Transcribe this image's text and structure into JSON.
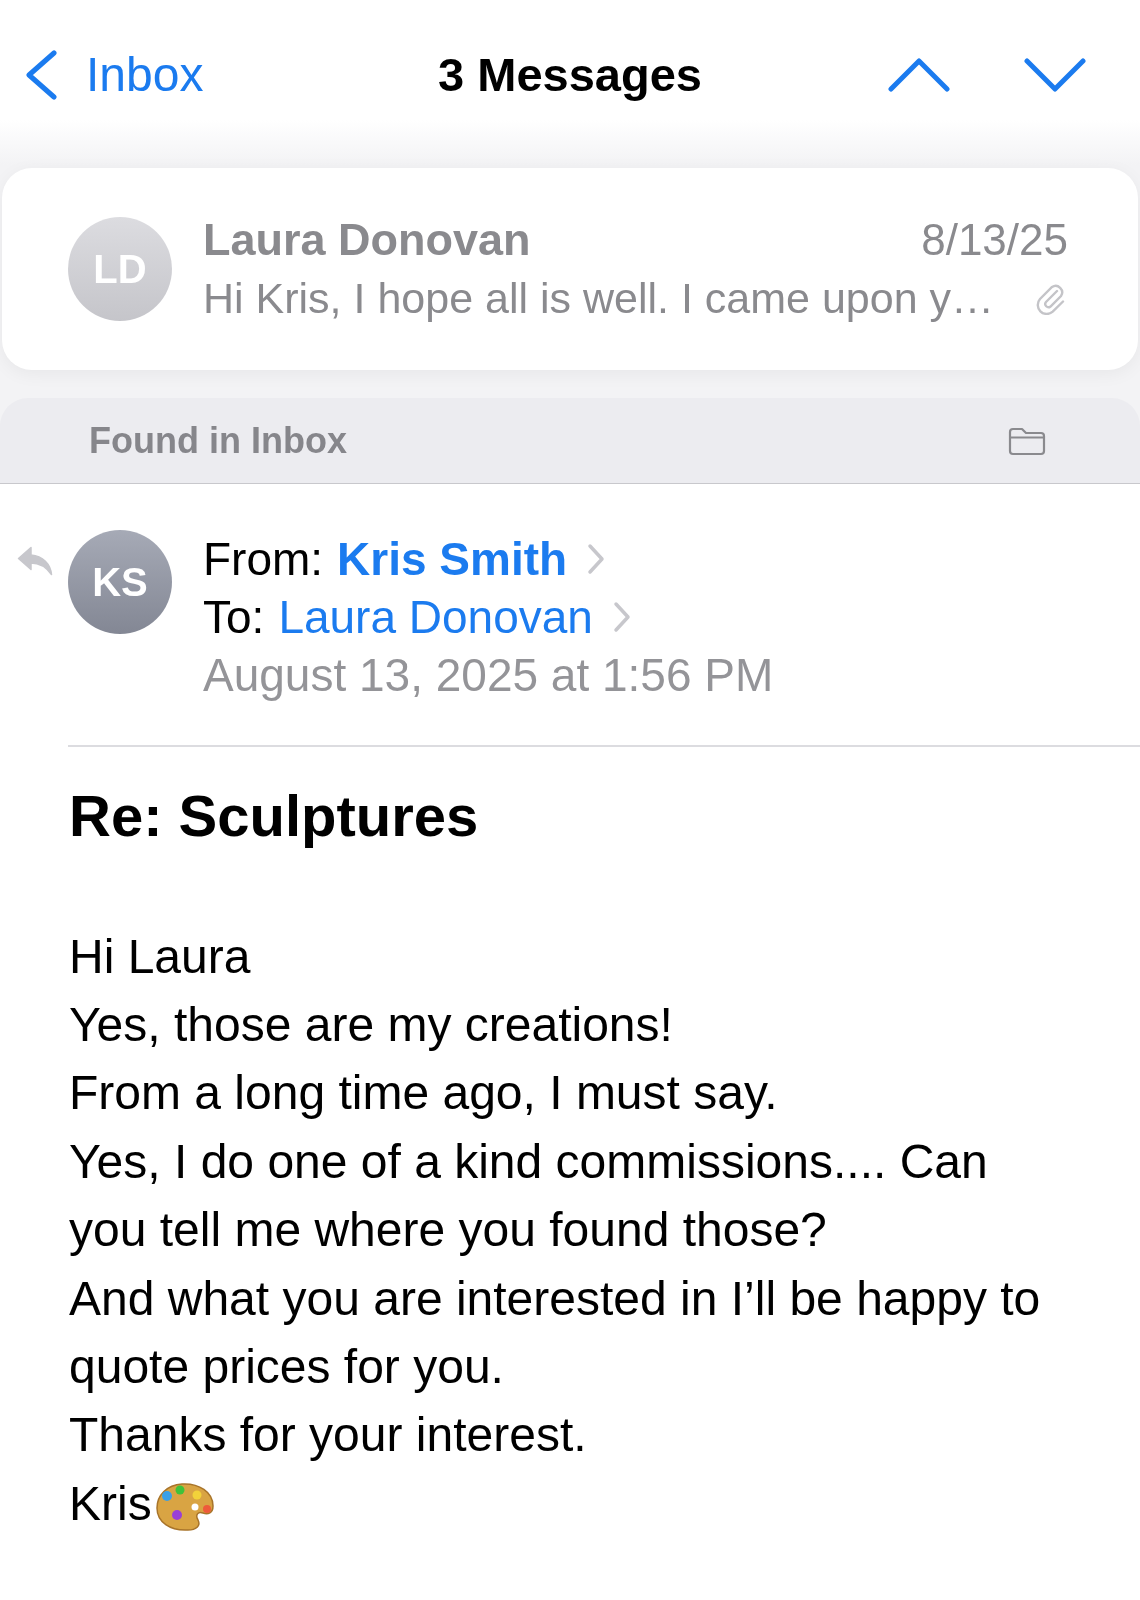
{
  "nav": {
    "back_label": "Inbox",
    "title": "3 Messages"
  },
  "thread_summary": {
    "avatar_initials": "LD",
    "sender": "Laura Donovan",
    "date": "8/13/25",
    "preview": "Hi Kris, I hope all is well. I came upon y…",
    "has_attachment": true
  },
  "found_in": {
    "label": "Found in Inbox"
  },
  "message": {
    "replied": true,
    "avatar_initials": "KS",
    "from_label": "From:",
    "from_name": "Kris Smith",
    "to_label": "To:",
    "to_name": "Laura Donovan",
    "date": "August 13, 2025 at 1:56 PM",
    "subject": "Re: Sculptures",
    "body": [
      "Hi Laura",
      "Yes, those are my creations!",
      "From a long time ago, I must say.",
      "Yes, I do one of a kind commissions.... Can you tell me where you found those?",
      "And what you are interested in I’ll be happy to quote prices for you.",
      "Thanks for your interest."
    ],
    "signature": "Kris"
  }
}
